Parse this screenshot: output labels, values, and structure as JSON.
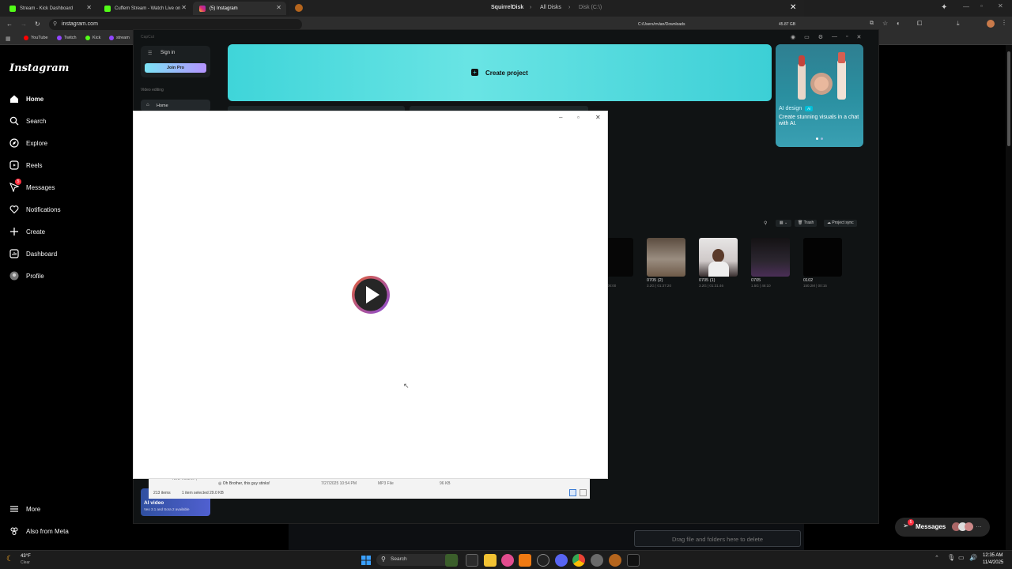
{
  "browser": {
    "tabs": [
      {
        "label": "Stream - Kick Dashboard",
        "active": false
      },
      {
        "label": "Cuffem Stream - Watch Live on",
        "active": false
      },
      {
        "label": "(5) Instagram",
        "active": true
      }
    ],
    "url": "instagram.com",
    "bookmarks": [
      "YouTube",
      "Twitch",
      "Kick",
      "stream"
    ]
  },
  "instagram": {
    "logo": "Instagram",
    "nav": [
      {
        "label": "Home",
        "icon": "home-icon"
      },
      {
        "label": "Search",
        "icon": "search-icon"
      },
      {
        "label": "Explore",
        "icon": "explore-icon"
      },
      {
        "label": "Reels",
        "icon": "reels-icon"
      },
      {
        "label": "Messages",
        "icon": "messages-icon",
        "badge": "5"
      },
      {
        "label": "Notifications",
        "icon": "heart-icon"
      },
      {
        "label": "Create",
        "icon": "plus-icon"
      },
      {
        "label": "Dashboard",
        "icon": "dashboard-icon"
      },
      {
        "label": "Profile",
        "icon": "avatar-icon"
      }
    ],
    "more": "More",
    "also_from_meta": "Also from Meta",
    "messages_pill": {
      "label": "Messages",
      "badge": "5"
    }
  },
  "squirreldisk": {
    "title": "SquirrelDisk",
    "crumbs": [
      "All Disks",
      "Disk (C:\\)"
    ],
    "path": "C:/Users/rrvlan/Downloads",
    "size": "45.87 GB",
    "drop_zone": "Drag file and folders here to delete"
  },
  "capcut": {
    "app_title": "CapCut",
    "sign_in": "Sign in",
    "join_pro": "Join Pro",
    "section": "Video editing",
    "home": "Home",
    "create_project": "Create project",
    "ai_card": {
      "tag": "AI design",
      "badge": "AI",
      "text": "Create stunning visuals in a chat with AI."
    },
    "toolbar": {
      "trash": "Trash",
      "project_sync": "Project sync"
    },
    "ai_video": {
      "label": "AI video",
      "sub": "Veo 3.1 and Sora 2 available"
    },
    "projects": [
      {
        "name": "",
        "meta": "00:00",
        "color": "#060606"
      },
      {
        "name": "0705 (2)",
        "meta": "3.2G | 01:37:20",
        "color": "#7a6a5a"
      },
      {
        "name": "0705 (1)",
        "meta": "3.2G | 01:31:46",
        "color": "#d8d6d6"
      },
      {
        "name": "0705",
        "meta": "1.5G | 46:10",
        "color": "#1a181a"
      },
      {
        "name": "0102",
        "meta": "150.2M | 00:15",
        "color": "#030303"
      }
    ]
  },
  "explorer": {
    "row_name": "Oh Brother, this guy stinks!",
    "row_date": "7/27/2025 10:54 PM",
    "row_type": "MP3 File",
    "row_size": "96 KB",
    "folder": "New Volume (",
    "status_items": "213 items",
    "status_selected": "1 item selected  29.0 KB"
  },
  "taskbar": {
    "weather_temp": "43°F",
    "weather_desc": "Clear",
    "search": "Search",
    "time": "12:35 AM",
    "date": "11/4/2025"
  }
}
